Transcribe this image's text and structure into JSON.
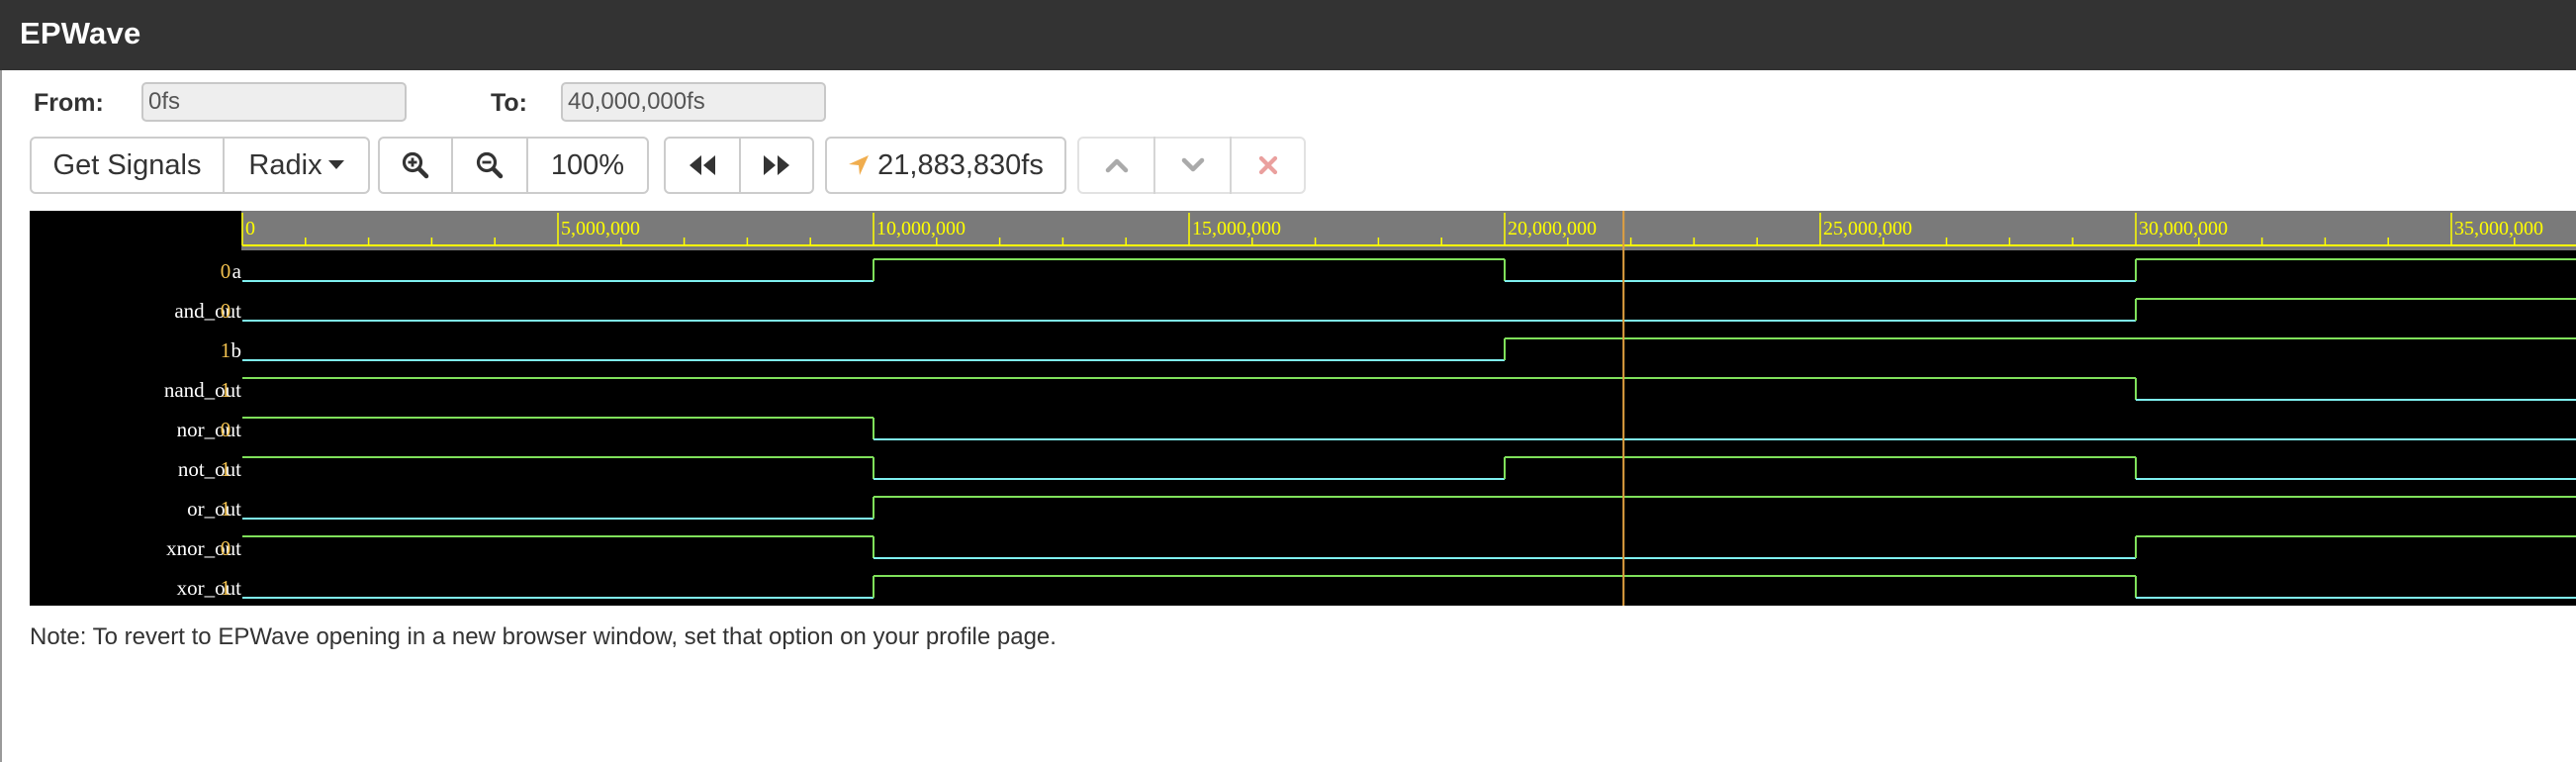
{
  "app": {
    "title": "EPWave"
  },
  "range": {
    "from_label": "From:",
    "from_value": "0fs",
    "to_label": "To:",
    "to_value": "40,000,000fs"
  },
  "toolbar": {
    "get_signals": "Get Signals",
    "radix": "Radix",
    "zoom_level": "100%",
    "cursor_time": "21,883,830fs"
  },
  "icons": {
    "zoom_in": "zoom-in-icon",
    "zoom_out": "zoom-out-icon",
    "step_back": "fast-backward-icon",
    "step_forward": "fast-forward-icon",
    "cursor": "location-arrow-icon",
    "up": "chevron-up-icon",
    "down": "chevron-down-icon",
    "remove": "close-icon",
    "caret": "caret-down-icon"
  },
  "colors": {
    "cursor_icon": "#f0ad4e",
    "remove_icon": "#e8a0a0",
    "ruler_text": "#ffff00",
    "signal_high": "#7fe05a",
    "signal_low": "#7ff0f0",
    "cursor_line": "#e0a040",
    "value_text": "#f2c14e"
  },
  "ruler": {
    "labels": [
      "0",
      "5,000,000",
      "10,000,000",
      "15,000,000",
      "20,000,000",
      "25,000,000",
      "30,000,000",
      "35,000,000"
    ]
  },
  "cursor_time_fs": 21883830,
  "signals": [
    {
      "name": "a",
      "value": "0",
      "initial": 0,
      "transitions": [
        10000000,
        20000000,
        30000000
      ]
    },
    {
      "name": "and_out",
      "value": "0",
      "initial": 0,
      "transitions": [
        30000000
      ]
    },
    {
      "name": "b",
      "value": "1",
      "initial": 0,
      "transitions": [
        20000000
      ]
    },
    {
      "name": "nand_out",
      "value": "1",
      "initial": 1,
      "transitions": [
        30000000
      ]
    },
    {
      "name": "nor_out",
      "value": "0",
      "initial": 1,
      "transitions": [
        10000000
      ]
    },
    {
      "name": "not_out",
      "value": "1",
      "initial": 1,
      "transitions": [
        10000000,
        20000000,
        30000000
      ]
    },
    {
      "name": "or_out",
      "value": "1",
      "initial": 0,
      "transitions": [
        10000000
      ]
    },
    {
      "name": "xnor_out",
      "value": "0",
      "initial": 1,
      "transitions": [
        10000000,
        30000000
      ]
    },
    {
      "name": "xor_out",
      "value": "1",
      "initial": 0,
      "transitions": [
        10000000,
        30000000
      ]
    }
  ],
  "note": "Note: To revert to EPWave opening in a new browser window, set that option on your profile page."
}
